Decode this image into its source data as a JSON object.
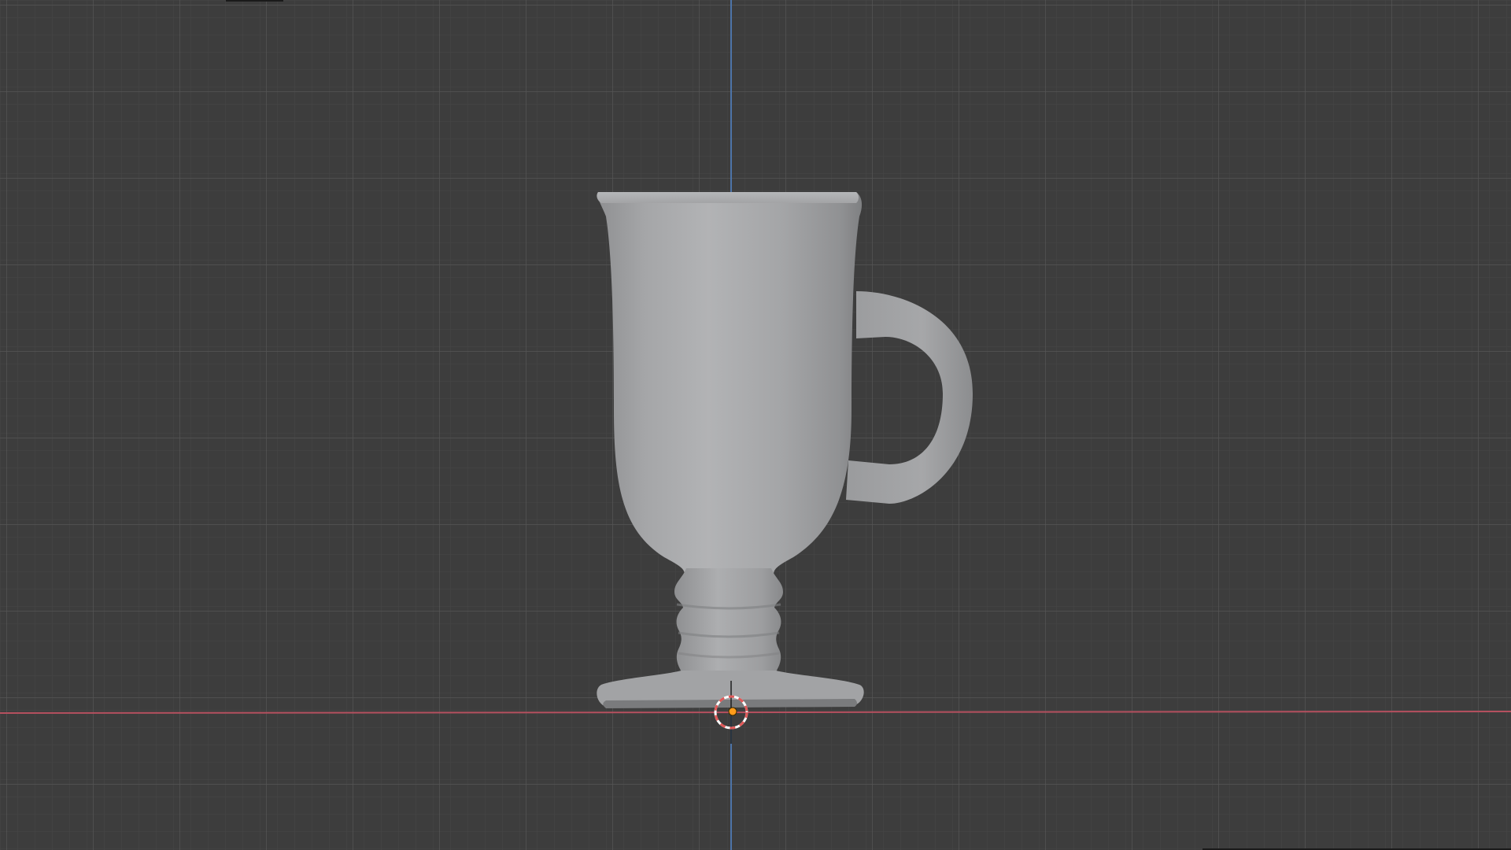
{
  "viewport": {
    "view": "front-orthographic",
    "background_color": "#3d3d3d",
    "grid_minor_color": "#474747",
    "grid_major_color": "#555555",
    "x_axis_color": "#b5505f",
    "z_axis_color": "#4d74a8"
  },
  "object": {
    "type": "mesh",
    "depicts": "mug",
    "color": "#a9abad"
  },
  "cursor_3d": {
    "ring_colors": [
      "#e05858",
      "#ffffff"
    ],
    "origin_color": "#ff9b1a"
  },
  "icons": {
    "cursor": "3d-cursor-icon",
    "origin": "origin-point-icon"
  }
}
